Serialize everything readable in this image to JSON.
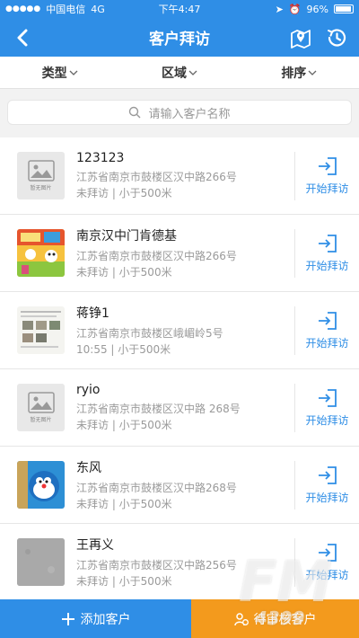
{
  "status_bar": {
    "carrier": "中国电信",
    "network": "4G",
    "time": "下午4:47",
    "battery": "96%"
  },
  "nav": {
    "title": "客户拜访",
    "back_icon": "chevron-left-icon",
    "map_icon": "map-pin-icon",
    "history_icon": "history-clock-icon"
  },
  "filters": [
    {
      "label": "类型"
    },
    {
      "label": "区域"
    },
    {
      "label": "排序"
    }
  ],
  "search": {
    "placeholder": "请输入客户名称"
  },
  "placeholder_image_text": "暂无图片",
  "customers": [
    {
      "name": "123123",
      "address": "江苏省南京市鼓楼区汉中路266号",
      "meta": "未拜访 | 小于500米",
      "thumb": "placeholder",
      "action": "开始拜访"
    },
    {
      "name": "南京汉中门肯德基",
      "address": "江苏省南京市鼓楼区汉中路266号",
      "meta": "未拜访 | 小于500米",
      "thumb": "colorful",
      "action": "开始拜访"
    },
    {
      "name": "蒋铮1",
      "address": "江苏省南京市鼓楼区峨嵋岭5号",
      "meta": "10:55 | 小于500米",
      "thumb": "document",
      "action": "开始拜访"
    },
    {
      "name": "ryio",
      "address": "江苏省南京市鼓楼区汉中路 268号",
      "meta": "未拜访 | 小于500米",
      "thumb": "placeholder",
      "action": "开始拜访"
    },
    {
      "name": "东风",
      "address": "江苏省南京市鼓楼区汉中路268号",
      "meta": "未拜访 | 小于500米",
      "thumb": "cartoon",
      "action": "开始拜访"
    },
    {
      "name": "王再义",
      "address": "江苏省南京市鼓楼区汉中路256号",
      "meta": "未拜访 | 小于500米",
      "thumb": "gray",
      "action": "开始拜访"
    }
  ],
  "bottom": {
    "add_label": "添加客户",
    "pending_label": "待审核客户"
  },
  "watermark": {
    "big": "FM",
    "small": "4399"
  },
  "colors": {
    "primary": "#2f8ee6",
    "orange": "#f39a1d"
  }
}
